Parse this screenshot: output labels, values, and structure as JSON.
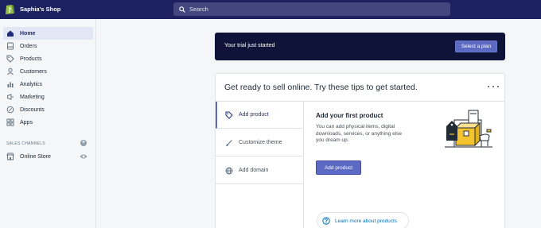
{
  "topbar": {
    "store_name": "Saphia's Shop",
    "search_placeholder": "Search"
  },
  "sidebar": {
    "items": [
      {
        "label": "Home",
        "icon": "home-icon",
        "active": true
      },
      {
        "label": "Orders",
        "icon": "orders-icon"
      },
      {
        "label": "Products",
        "icon": "products-icon"
      },
      {
        "label": "Customers",
        "icon": "customers-icon"
      },
      {
        "label": "Analytics",
        "icon": "analytics-icon"
      },
      {
        "label": "Marketing",
        "icon": "marketing-icon"
      },
      {
        "label": "Discounts",
        "icon": "discounts-icon"
      },
      {
        "label": "Apps",
        "icon": "apps-icon"
      }
    ],
    "sales_channels_header": "SALES CHANNELS",
    "channels": [
      {
        "label": "Online Store",
        "icon": "online-store-icon"
      }
    ]
  },
  "trial_banner": {
    "text": "Your trial just started",
    "button_label": "Select a plan"
  },
  "tips_card": {
    "title": "Get ready to sell online. Try these tips to get started.",
    "tabs": [
      {
        "label": "Add product",
        "icon": "tag-icon",
        "active": true
      },
      {
        "label": "Customize theme",
        "icon": "brush-icon"
      },
      {
        "label": "Add domain",
        "icon": "globe-icon"
      }
    ],
    "content": {
      "heading": "Add your first product",
      "description": "You can add physical items, digital downloads, services, or anything else you dream up.",
      "button_label": "Add product",
      "learn_more_label": "Learn more about products"
    }
  },
  "colors": {
    "topbar_bg": "#1c2260",
    "accent": "#5c6ac4",
    "trial_bg": "#0f1339",
    "link": "#006fbb"
  }
}
